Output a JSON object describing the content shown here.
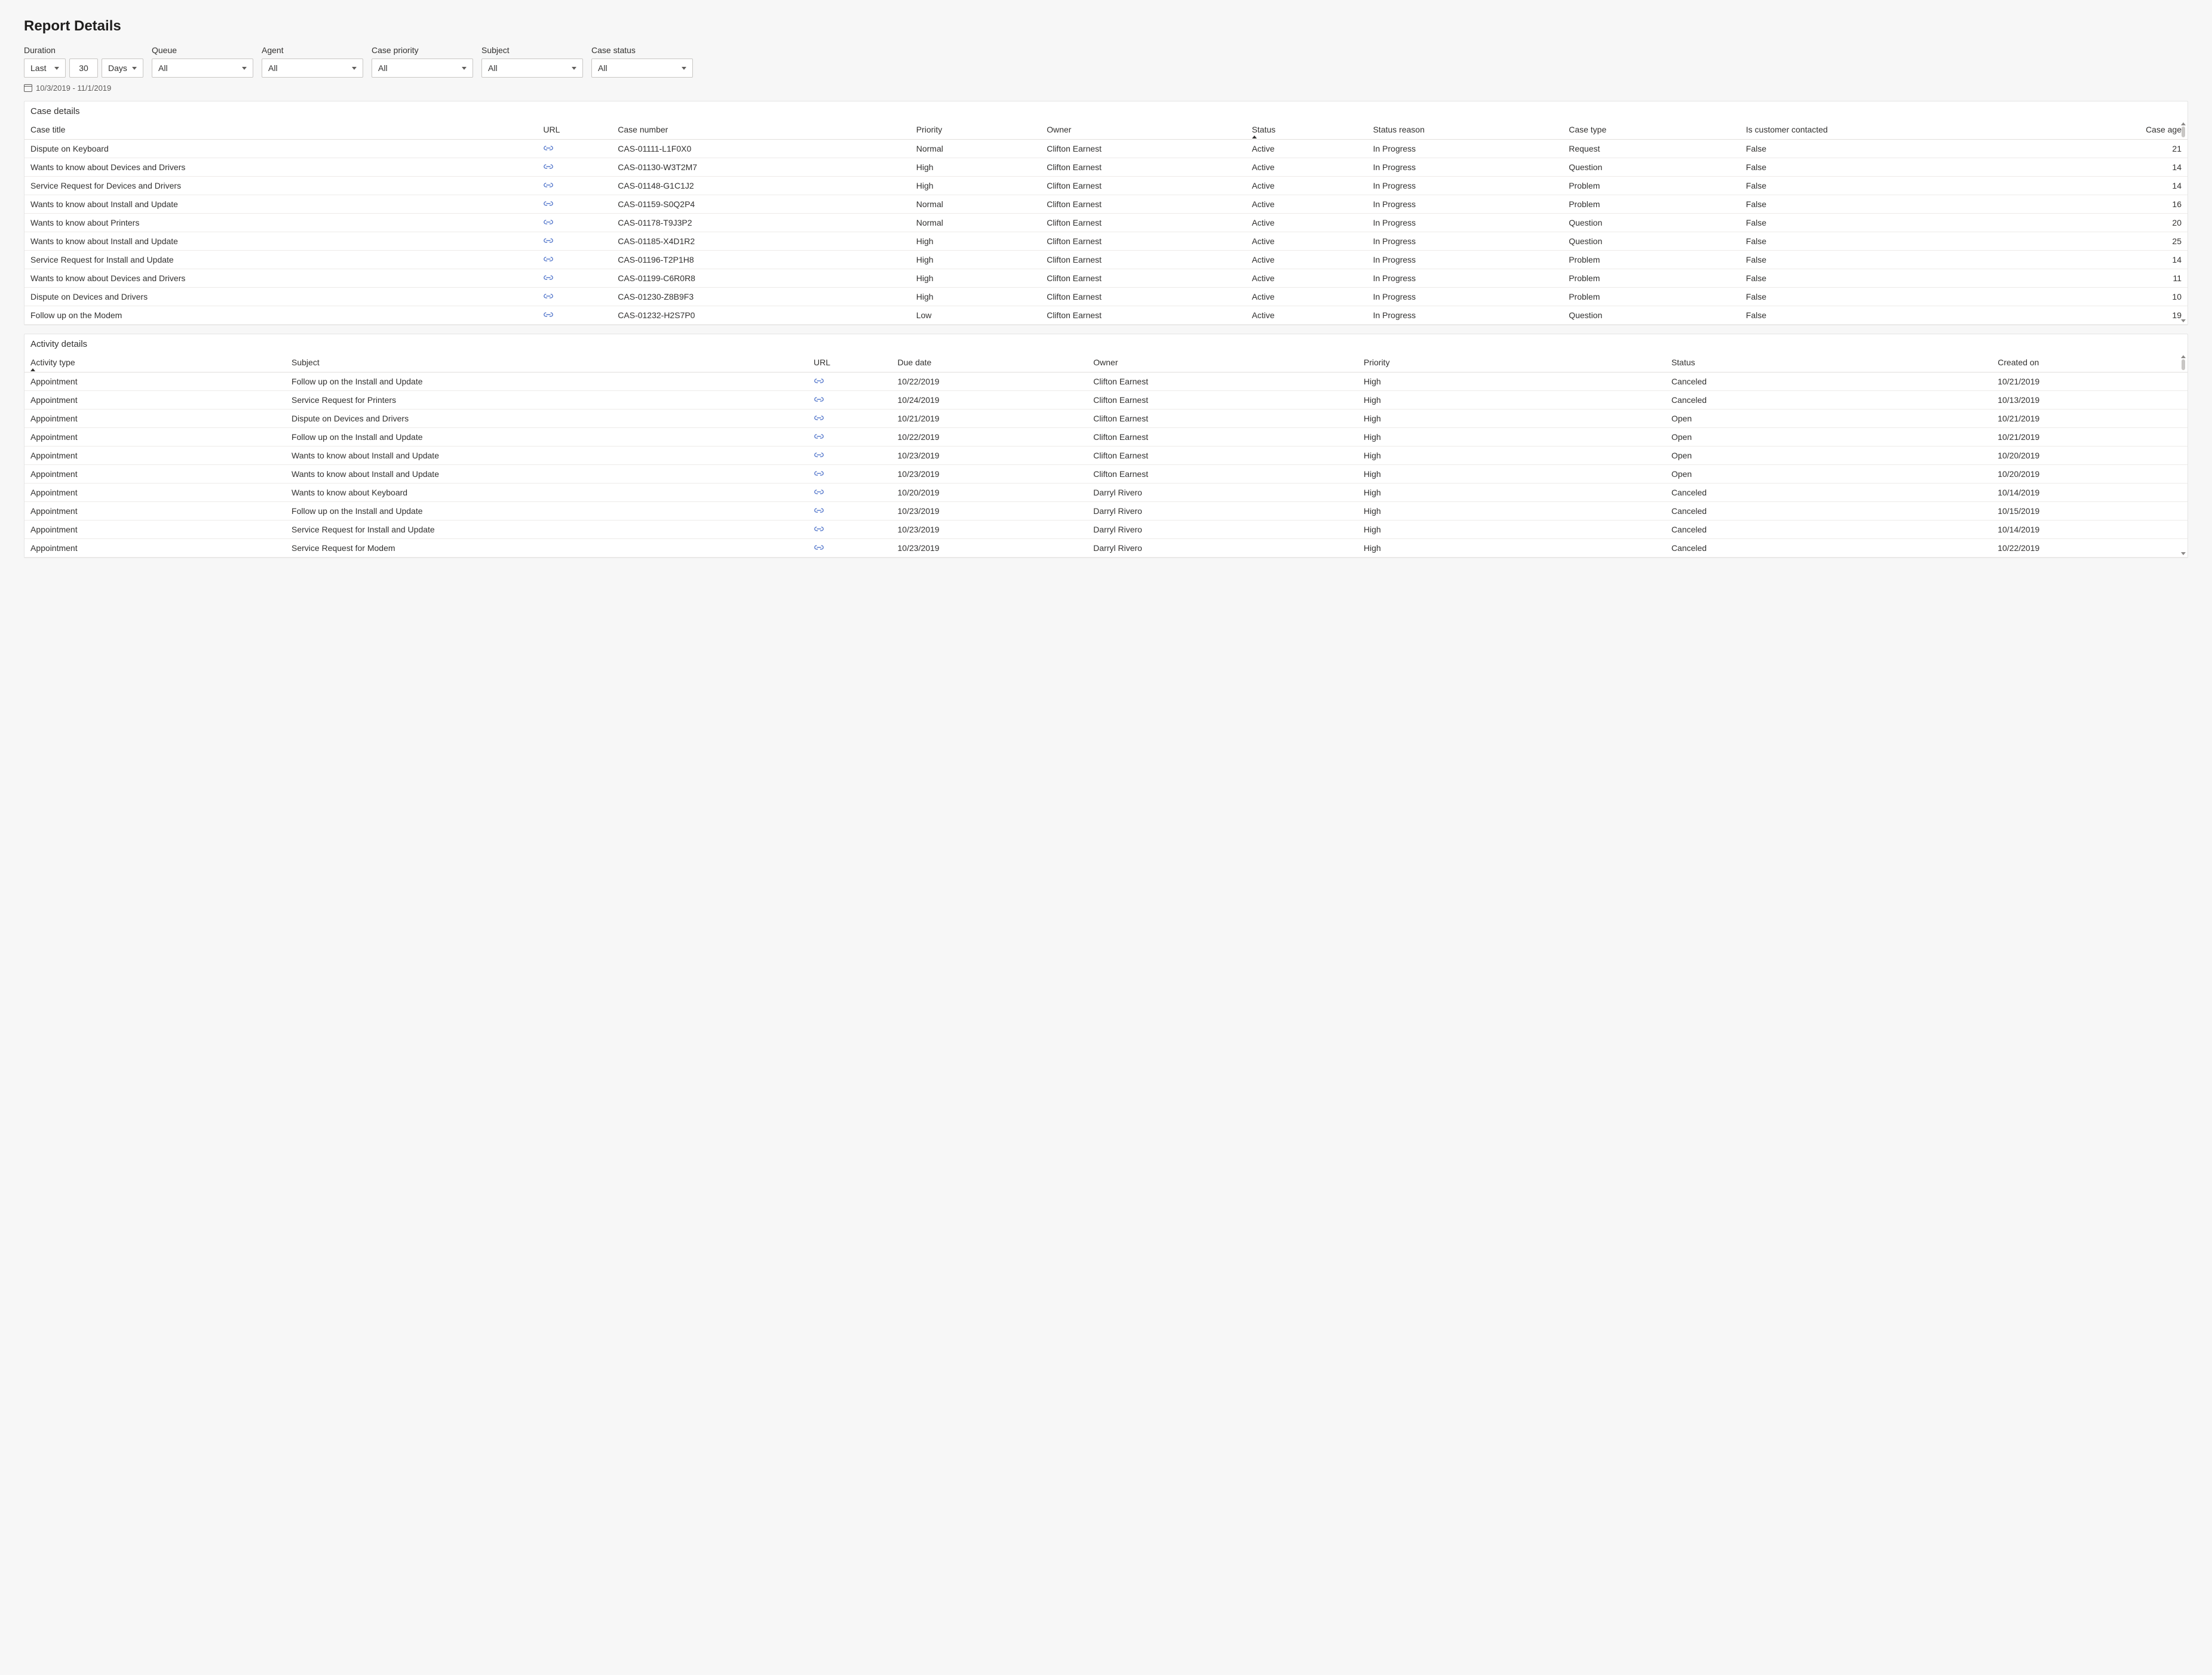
{
  "page_title": "Report Details",
  "filters": {
    "duration": {
      "label": "Duration",
      "relative": "Last",
      "value": "30",
      "unit": "Days",
      "date_range": "10/3/2019 - 11/1/2019"
    },
    "queue": {
      "label": "Queue",
      "value": "All"
    },
    "agent": {
      "label": "Agent",
      "value": "All"
    },
    "case_priority": {
      "label": "Case priority",
      "value": "All"
    },
    "subject": {
      "label": "Subject",
      "value": "All"
    },
    "case_status": {
      "label": "Case status",
      "value": "All"
    }
  },
  "case_details": {
    "title": "Case details",
    "columns": [
      "Case title",
      "URL",
      "Case number",
      "Priority",
      "Owner",
      "Status",
      "Status reason",
      "Case type",
      "Is customer contacted",
      "Case age"
    ],
    "sort_column": "Status",
    "rows": [
      {
        "title": "Dispute on Keyboard",
        "case_number": "CAS-01111-L1F0X0",
        "priority": "Normal",
        "owner": "Clifton Earnest",
        "status": "Active",
        "status_reason": "In Progress",
        "case_type": "Request",
        "contacted": "False",
        "age": "21"
      },
      {
        "title": "Wants to know about Devices and Drivers",
        "case_number": "CAS-01130-W3T2M7",
        "priority": "High",
        "owner": "Clifton Earnest",
        "status": "Active",
        "status_reason": "In Progress",
        "case_type": "Question",
        "contacted": "False",
        "age": "14"
      },
      {
        "title": "Service Request for Devices and Drivers",
        "case_number": "CAS-01148-G1C1J2",
        "priority": "High",
        "owner": "Clifton Earnest",
        "status": "Active",
        "status_reason": "In Progress",
        "case_type": "Problem",
        "contacted": "False",
        "age": "14"
      },
      {
        "title": "Wants to know about Install and Update",
        "case_number": "CAS-01159-S0Q2P4",
        "priority": "Normal",
        "owner": "Clifton Earnest",
        "status": "Active",
        "status_reason": "In Progress",
        "case_type": "Problem",
        "contacted": "False",
        "age": "16"
      },
      {
        "title": "Wants to know about Printers",
        "case_number": "CAS-01178-T9J3P2",
        "priority": "Normal",
        "owner": "Clifton Earnest",
        "status": "Active",
        "status_reason": "In Progress",
        "case_type": "Question",
        "contacted": "False",
        "age": "20"
      },
      {
        "title": "Wants to know about Install and Update",
        "case_number": "CAS-01185-X4D1R2",
        "priority": "High",
        "owner": "Clifton Earnest",
        "status": "Active",
        "status_reason": "In Progress",
        "case_type": "Question",
        "contacted": "False",
        "age": "25"
      },
      {
        "title": "Service Request for Install and Update",
        "case_number": "CAS-01196-T2P1H8",
        "priority": "High",
        "owner": "Clifton Earnest",
        "status": "Active",
        "status_reason": "In Progress",
        "case_type": "Problem",
        "contacted": "False",
        "age": "14"
      },
      {
        "title": "Wants to know about Devices and Drivers",
        "case_number": "CAS-01199-C6R0R8",
        "priority": "High",
        "owner": "Clifton Earnest",
        "status": "Active",
        "status_reason": "In Progress",
        "case_type": "Problem",
        "contacted": "False",
        "age": "11"
      },
      {
        "title": "Dispute on Devices and Drivers",
        "case_number": "CAS-01230-Z8B9F3",
        "priority": "High",
        "owner": "Clifton Earnest",
        "status": "Active",
        "status_reason": "In Progress",
        "case_type": "Problem",
        "contacted": "False",
        "age": "10"
      },
      {
        "title": "Follow up on the  Modem",
        "case_number": "CAS-01232-H2S7P0",
        "priority": "Low",
        "owner": "Clifton Earnest",
        "status": "Active",
        "status_reason": "In Progress",
        "case_type": "Question",
        "contacted": "False",
        "age": "19"
      }
    ]
  },
  "activity_details": {
    "title": "Activity details",
    "columns": [
      "Activity type",
      "Subject",
      "URL",
      "Due date",
      "Owner",
      "Priority",
      "Status",
      "Created on"
    ],
    "sort_column": "Activity type",
    "rows": [
      {
        "type": "Appointment",
        "subject": "Follow up on the Install and Update",
        "due": "10/22/2019",
        "owner": "Clifton Earnest",
        "priority": "High",
        "status": "Canceled",
        "created": "10/21/2019"
      },
      {
        "type": "Appointment",
        "subject": "Service Request for Printers",
        "due": "10/24/2019",
        "owner": "Clifton Earnest",
        "priority": "High",
        "status": "Canceled",
        "created": "10/13/2019"
      },
      {
        "type": "Appointment",
        "subject": "Dispute on Devices and Drivers",
        "due": "10/21/2019",
        "owner": "Clifton Earnest",
        "priority": "High",
        "status": "Open",
        "created": "10/21/2019"
      },
      {
        "type": "Appointment",
        "subject": "Follow up on the Install and Update",
        "due": "10/22/2019",
        "owner": "Clifton Earnest",
        "priority": "High",
        "status": "Open",
        "created": "10/21/2019"
      },
      {
        "type": "Appointment",
        "subject": "Wants to know about Install and Update",
        "due": "10/23/2019",
        "owner": "Clifton Earnest",
        "priority": "High",
        "status": "Open",
        "created": "10/20/2019"
      },
      {
        "type": "Appointment",
        "subject": "Wants to know about Install and Update",
        "due": "10/23/2019",
        "owner": "Clifton Earnest",
        "priority": "High",
        "status": "Open",
        "created": "10/20/2019"
      },
      {
        "type": "Appointment",
        "subject": "Wants to know about Keyboard",
        "due": "10/20/2019",
        "owner": "Darryl Rivero",
        "priority": "High",
        "status": "Canceled",
        "created": "10/14/2019"
      },
      {
        "type": "Appointment",
        "subject": "Follow up on the Install and Update",
        "due": "10/23/2019",
        "owner": "Darryl Rivero",
        "priority": "High",
        "status": "Canceled",
        "created": "10/15/2019"
      },
      {
        "type": "Appointment",
        "subject": "Service Request for Install and Update",
        "due": "10/23/2019",
        "owner": "Darryl Rivero",
        "priority": "High",
        "status": "Canceled",
        "created": "10/14/2019"
      },
      {
        "type": "Appointment",
        "subject": "Service Request for Modem",
        "due": "10/23/2019",
        "owner": "Darryl Rivero",
        "priority": "High",
        "status": "Canceled",
        "created": "10/22/2019"
      }
    ]
  }
}
